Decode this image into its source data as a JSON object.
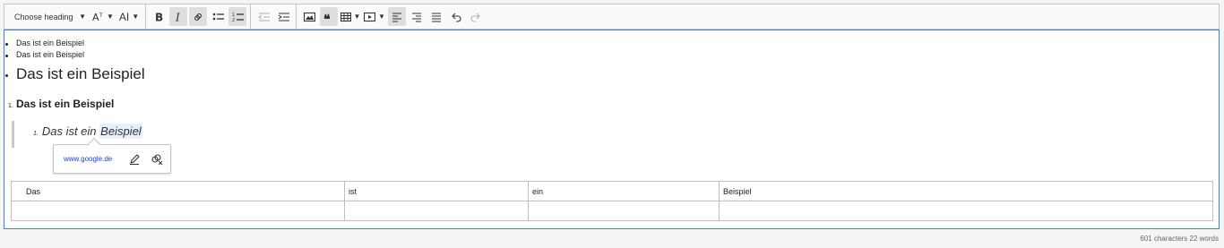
{
  "toolbar": {
    "heading_dropdown": "Choose heading",
    "font_size_label": "A",
    "font_family_label": "AI",
    "buttons": [
      "bold",
      "italic",
      "link",
      "bulleted-list",
      "numbered-list",
      "outdent",
      "indent",
      "image",
      "block-quote",
      "table",
      "media",
      "align-left",
      "align-right",
      "align-justify",
      "undo",
      "redo"
    ]
  },
  "content": {
    "bullet_small_1": "Das ist ein Beispiel",
    "bullet_small_2": "Das ist ein Beispiel",
    "bullet_large": "Das ist ein Beispiel",
    "ordered_number": "1.",
    "ordered_bold": "Das ist ein Beispiel",
    "quote_number": "1.",
    "quote_text_plain": "Das ist ein ",
    "quote_text_link": "Beispiel"
  },
  "link_balloon": {
    "url": "www.google.de",
    "icons": [
      "edit-link-icon",
      "unlink-icon"
    ]
  },
  "table": {
    "rows": [
      [
        "Das",
        "ist",
        "ein",
        "Beispiel"
      ],
      [
        "",
        "",
        "",
        ""
      ]
    ]
  },
  "status": {
    "counter": "601 characters 22 words"
  },
  "colors": {
    "focus_border": "#3f7fd4",
    "link": "#1b3af2",
    "active_button": "#dedede"
  }
}
